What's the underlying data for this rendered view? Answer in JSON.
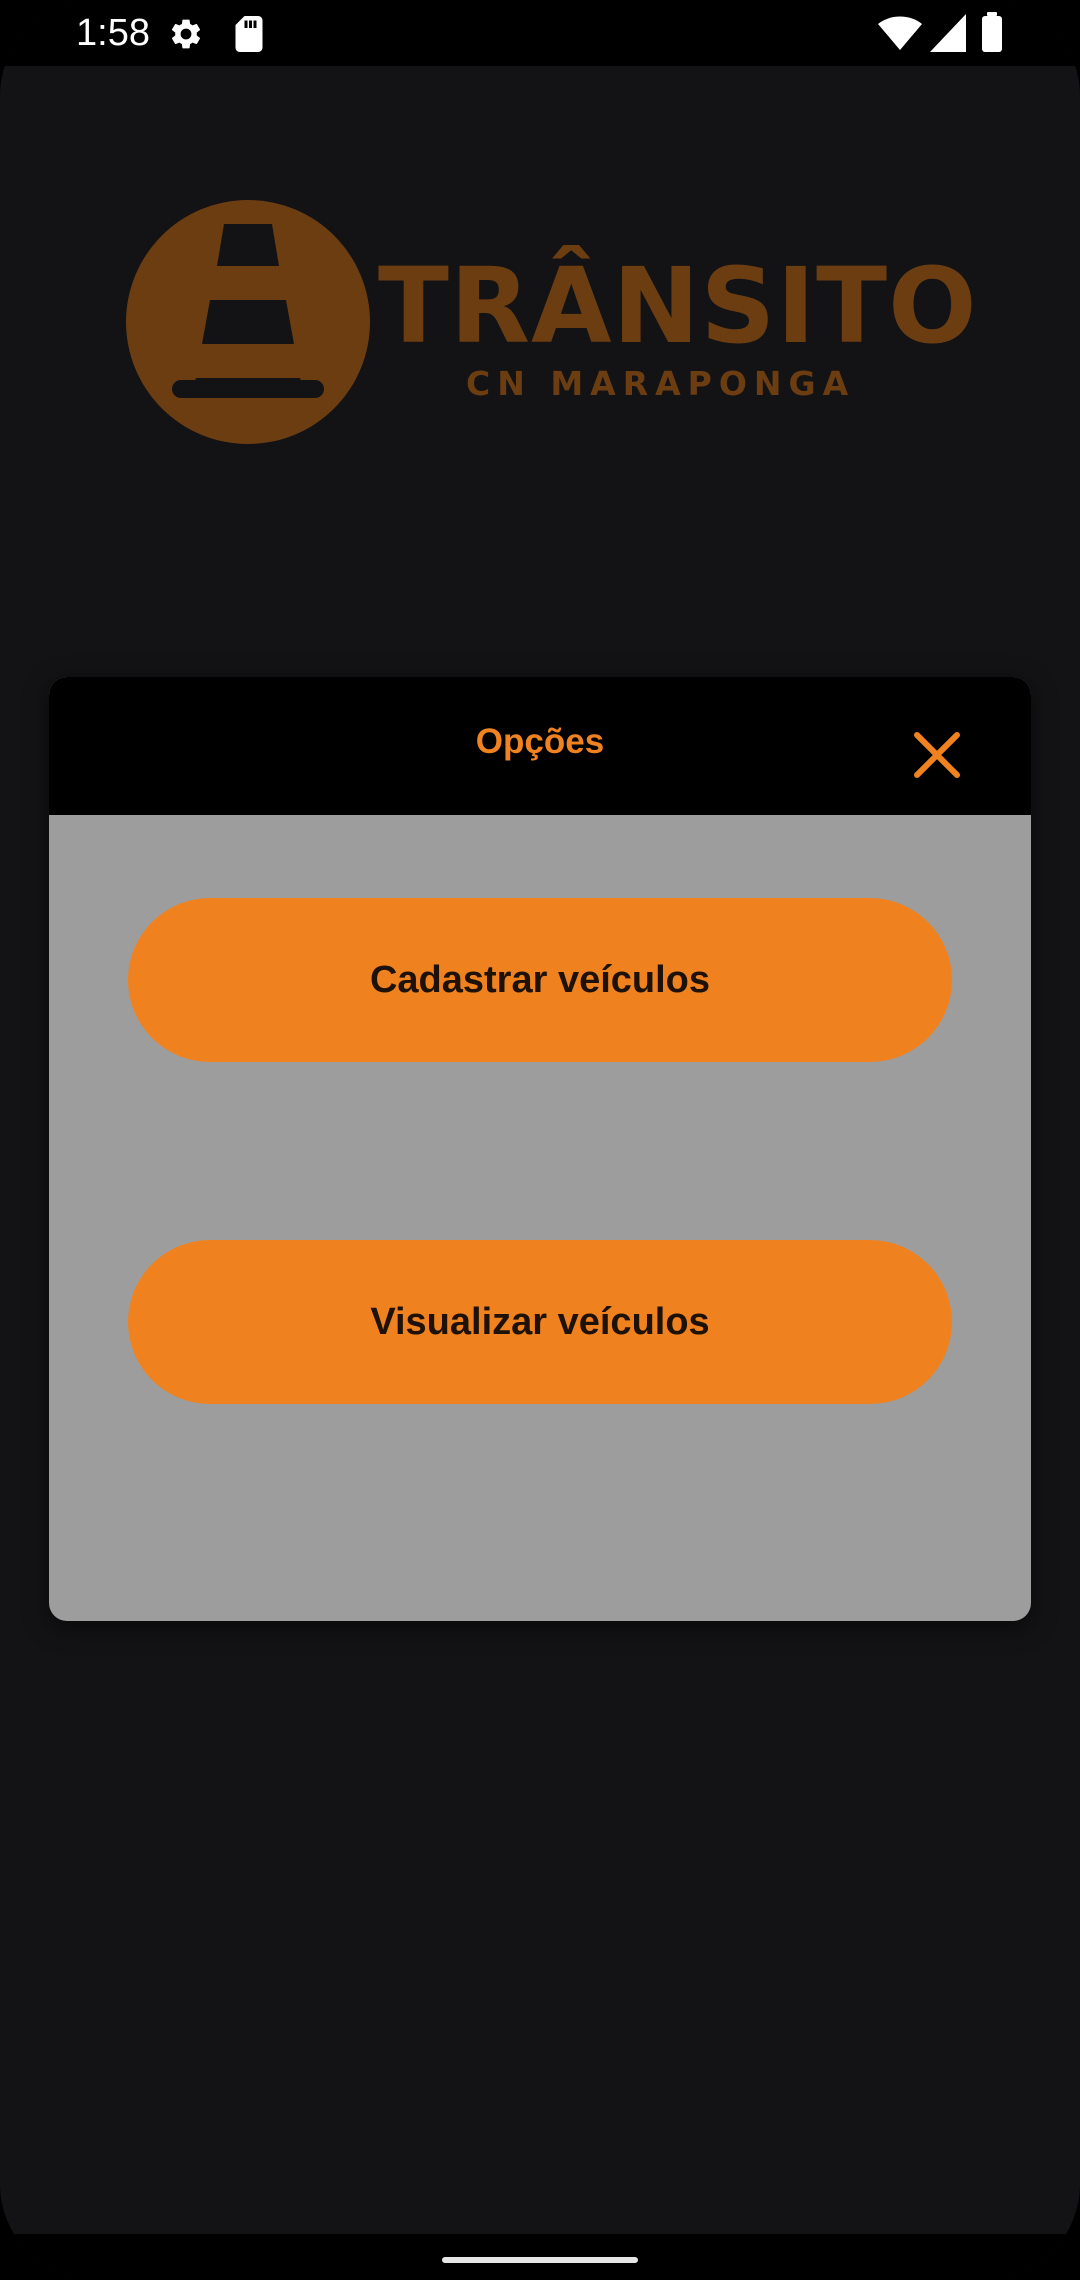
{
  "status_bar": {
    "time": "1:58",
    "icons_left": [
      "settings-icon",
      "sd-card-icon"
    ],
    "icons_right": [
      "wifi-icon",
      "signal-icon",
      "battery-icon"
    ]
  },
  "logo": {
    "title": "TRÂNSITO",
    "subtitle": "CN MARAPONGA",
    "icon": "traffic-cone-icon",
    "color": "#6d3d12"
  },
  "dialog": {
    "title": "Opções",
    "close_icon": "close-icon",
    "buttons": [
      {
        "label": "Cadastrar veículos"
      },
      {
        "label": "Visualizar veículos"
      }
    ]
  },
  "colors": {
    "accent": "#ef821f",
    "background": "#131315",
    "dialog_body": "#9d9d9d",
    "header": "#000000"
  }
}
